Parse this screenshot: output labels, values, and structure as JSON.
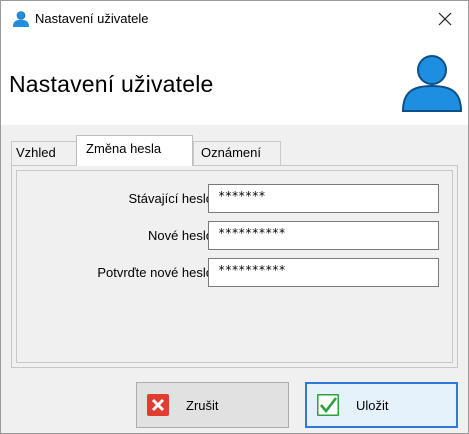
{
  "window": {
    "title": "Nastavení uživatele",
    "close_glyph": "✕"
  },
  "header": {
    "heading": "Nastavení uživatele",
    "icon": "user-avatar-icon"
  },
  "tabs": [
    {
      "label": "Vzhled",
      "active": false
    },
    {
      "label": "Změna hesla",
      "active": true
    },
    {
      "label": "Oznámení",
      "active": false
    }
  ],
  "form": {
    "current_password": {
      "label": "Stávající heslo",
      "value": "*******"
    },
    "new_password": {
      "label": "Nové heslo",
      "value": "**********"
    },
    "confirm_password": {
      "label": "Potvrďte nové heslo",
      "value": "**********"
    }
  },
  "buttons": {
    "cancel": {
      "label": "Zrušit",
      "icon": "red-x-icon"
    },
    "save": {
      "label": "Uložit",
      "icon": "green-check-icon"
    }
  },
  "colors": {
    "accent_blue": "#2d79d6",
    "cancel_red": "#e03c31",
    "save_green": "#2aa33b",
    "user_icon_blue": "#1e8fe0"
  }
}
